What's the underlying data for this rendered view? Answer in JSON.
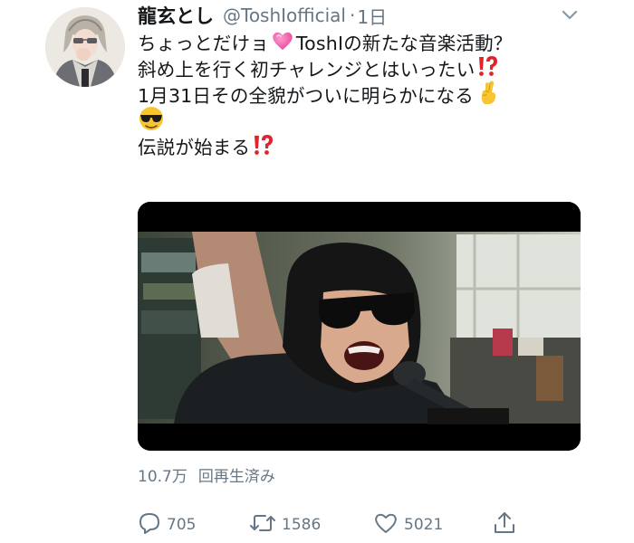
{
  "tweet": {
    "display_name": "龍玄とし",
    "handle": "@ToshIofficial",
    "separator": "·",
    "time": "1日",
    "text_lines": [
      [
        "ちょっとだけョ",
        "ToshIの新たな音楽活動？"
      ],
      [
        "斜め上を行く初チャレンジとはいったい"
      ],
      [
        "1月31日その全貌がついに明らかになる"
      ],
      [
        ""
      ],
      [
        "伝説が始まる"
      ]
    ],
    "media": {
      "type": "video"
    },
    "views": {
      "count": "10.7万",
      "label": "回再生済み"
    },
    "actions": {
      "reply_count": "705",
      "retweet_count": "1586",
      "like_count": "5021"
    },
    "icons": [
      "chevron-down-icon",
      "heart-emoji-icon",
      "exclamation-question-icon",
      "crossed-fingers-emoji-icon",
      "sunglasses-emoji-icon",
      "reply-icon",
      "retweet-icon",
      "like-icon",
      "share-icon"
    ],
    "colors": {
      "text": "#14171a",
      "secondary": "#657786",
      "pink_heart": "#f06bb0",
      "red_exclaim": "#e0242b",
      "emoji_yellow": "#f7c531"
    }
  }
}
